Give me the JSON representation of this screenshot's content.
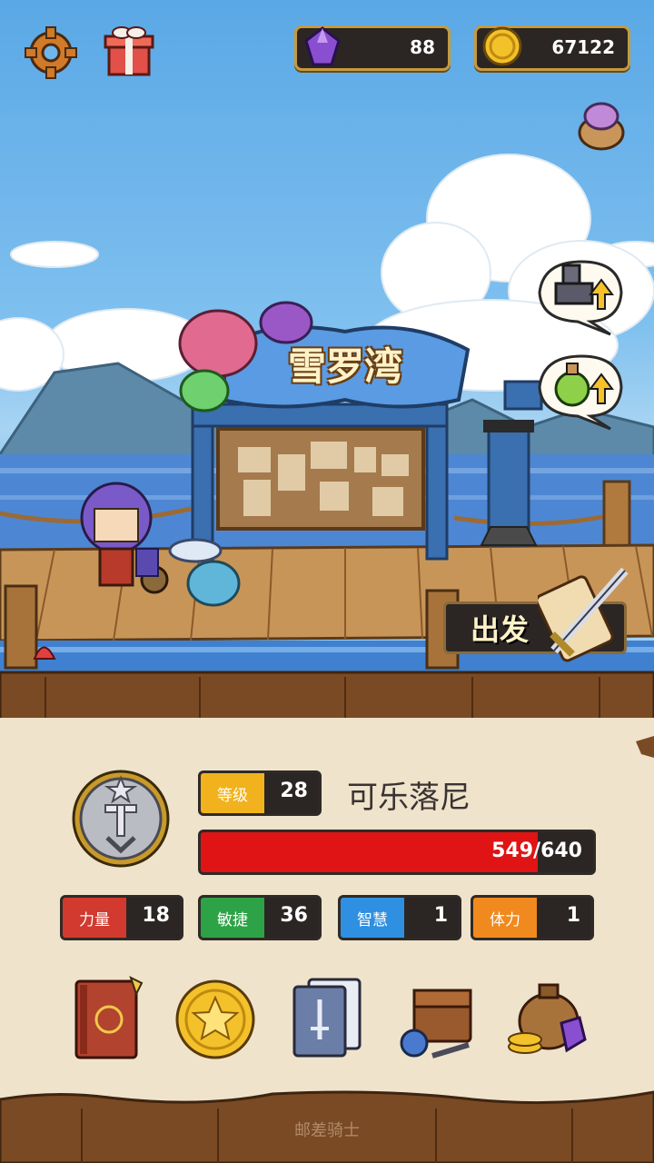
{
  "hud": {
    "gems": "88",
    "coins": "67122"
  },
  "location": {
    "sign": "雪罗湾"
  },
  "actions": {
    "depart_label": "出发"
  },
  "character": {
    "level_label": "等级",
    "level_value": "28",
    "name": "可乐落尼",
    "hp_text": "549/640",
    "hp_fraction": 0.858
  },
  "stats": [
    {
      "label": "力量",
      "value": "18",
      "color": "#d23a2f"
    },
    {
      "label": "敏捷",
      "value": "36",
      "color": "#2ea246"
    },
    {
      "label": "智慧",
      "value": "1",
      "color": "#2f8fe0"
    },
    {
      "label": "体力",
      "value": "1",
      "color": "#f08a1e"
    }
  ],
  "menu_icons": [
    "journal-book-icon",
    "star-coin-icon",
    "skill-cards-icon",
    "inventory-bag-icon",
    "shop-treasure-icon"
  ],
  "footer": {
    "title": "邮差骑士"
  },
  "colors": {
    "panel": "#efe3cc",
    "hp": "#e01414",
    "frame": "#c79a3d"
  }
}
